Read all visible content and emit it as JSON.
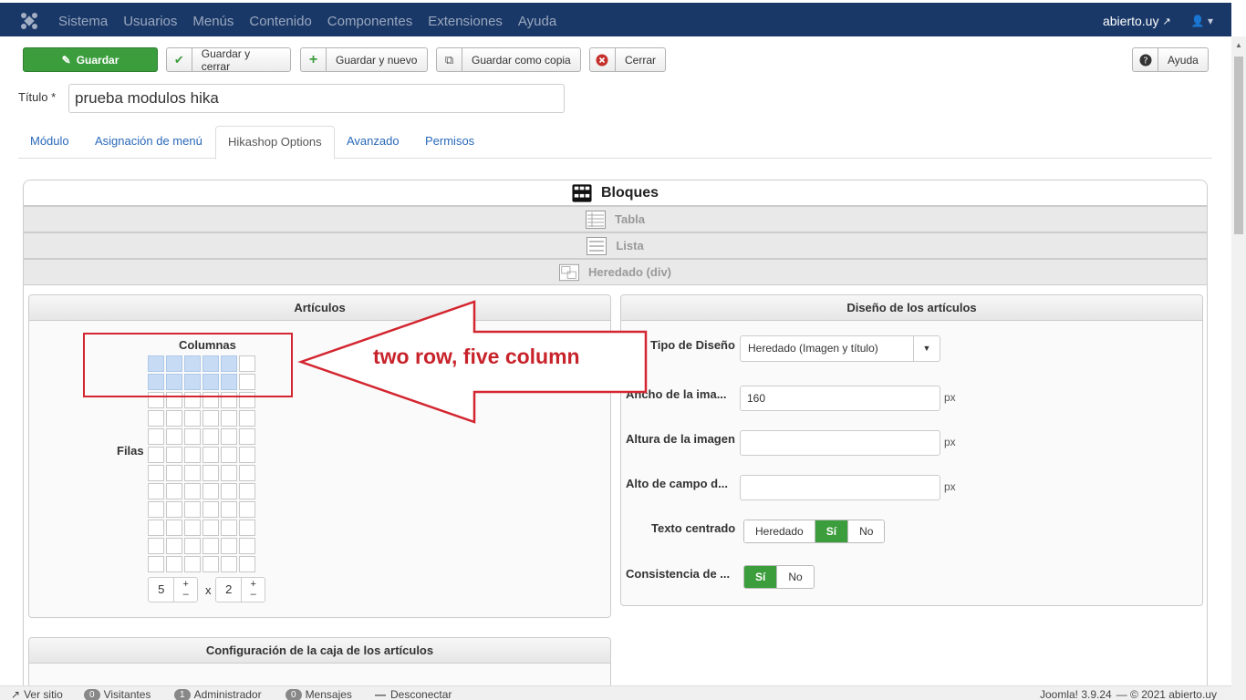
{
  "topnav": {
    "menu": [
      "Sistema",
      "Usuarios",
      "Menús",
      "Contenido",
      "Componentes",
      "Extensiones",
      "Ayuda"
    ],
    "site_link": "abierto.uy"
  },
  "toolbar": {
    "save": "Guardar",
    "save_close": "Guardar y cerrar",
    "save_new": "Guardar y nuevo",
    "save_copy": "Guardar como copia",
    "close": "Cerrar",
    "help": "Ayuda"
  },
  "title_field": {
    "label": "Título *",
    "value": "prueba modulos hika"
  },
  "tabs": [
    "Módulo",
    "Asignación de menú",
    "Hikashop Options",
    "Avanzado",
    "Permisos"
  ],
  "layouts": {
    "bloques": "Bloques",
    "tabla": "Tabla",
    "lista": "Lista",
    "heredado": "Heredado (div)"
  },
  "articulos": {
    "header": "Artículos",
    "columns_label": "Columnas",
    "rows_label": "Filas",
    "columns_value": "5",
    "times": "x",
    "rows_value": "2",
    "plus": "+",
    "minus": "–",
    "grid": {
      "cols": 6,
      "rows": 12,
      "selected_cols": 5,
      "selected_rows": 2
    }
  },
  "design": {
    "header": "Diseño de los artículos",
    "layout_type_label": "Tipo de Diseño",
    "layout_type_value": "Heredado (Imagen y título)",
    "image_width_label": "Ancho de la ima...",
    "image_width_value": "160",
    "image_height_label": "Altura de la imagen",
    "field_height_label": "Alto de campo d...",
    "unit": "px",
    "centered_label": "Texto centrado",
    "centered_options": [
      "Heredado",
      "Sí",
      "No"
    ],
    "consistency_label": "Consistencia de ...",
    "consistency_options": [
      "Sí",
      "No"
    ]
  },
  "box_config": {
    "header": "Configuración de la caja de los artículos"
  },
  "annotation": {
    "text": "two row, five column"
  },
  "statusbar": {
    "view_site": "Ver sitio",
    "visitors_count": "0",
    "visitors": "Visitantes",
    "admin_count": "1",
    "admin": "Administrador",
    "messages_count": "0",
    "messages": "Mensajes",
    "logout": "Desconectar",
    "version": "Joomla! 3.9.24",
    "copyright": "— © 2021 abierto.uy"
  },
  "colors": {
    "navbar": "#1a3867",
    "save_green": "#3c9d3d",
    "link_blue": "#2a69b8",
    "annotation_red": "#d32630",
    "selected_cell": "#c7dcf4"
  }
}
